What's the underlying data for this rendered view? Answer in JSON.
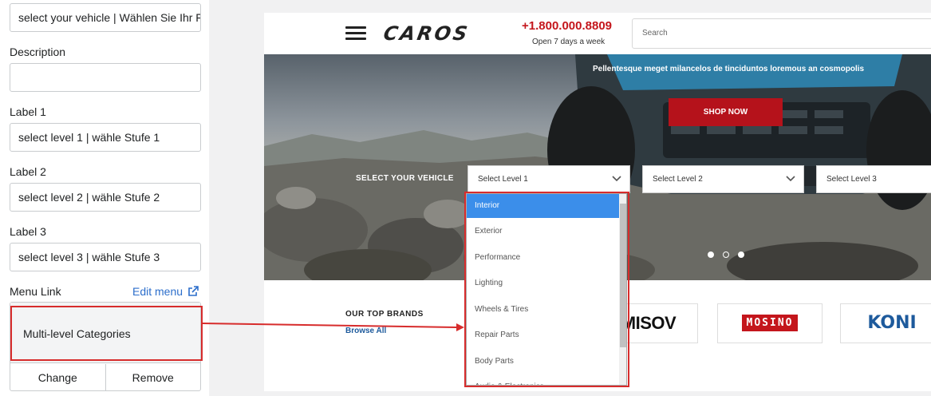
{
  "left_panel": {
    "title_value": "select your vehicle | Wählen Sie Ihr Fahrzeug",
    "description_label": "Description",
    "description_value": "",
    "label1_label": "Label 1",
    "label1_value": "select level 1 | wähle Stufe 1",
    "label2_label": "Label 2",
    "label2_value": "select level 2 | wähle Stufe 2",
    "label3_label": "Label 3",
    "label3_value": "select level 3 | wähle Stufe 3",
    "menu_link_label": "Menu Link",
    "edit_menu": "Edit menu",
    "menu_selected": "Multi-level Categories",
    "change_button": "Change",
    "remove_button": "Remove"
  },
  "site": {
    "logo": "CAROS",
    "phone": "+1.800.000.8809",
    "hours": "Open 7 days a week",
    "search_placeholder": "Search",
    "tagline": "Pellentesque meget milancelos de tinciduntos loremous an cosmopolis",
    "shop_now": "SHOP NOW",
    "select_vehicle_label": "SELECT YOUR VEHICLE",
    "select_level_1": "Select Level 1",
    "select_level_2": "Select Level 2",
    "select_level_3": "Select Level 3",
    "brands_title": "OUR TOP BRANDS",
    "browse_all": "Browse All",
    "brands": [
      "MISOV",
      "MOSINO",
      "KONI"
    ],
    "dropdown_items": [
      "Interior",
      "Exterior",
      "Performance",
      "Lighting",
      "Wheels & Tires",
      "Repair Parts",
      "Body Parts",
      "Audio & Electronics"
    ],
    "slide_count": 3,
    "active_slide": 1
  },
  "colors": {
    "accent_red": "#c4161c",
    "highlight_box": "#d72c2c",
    "link_blue": "#2c6ecb",
    "dropdown_active": "#3b8eea"
  }
}
